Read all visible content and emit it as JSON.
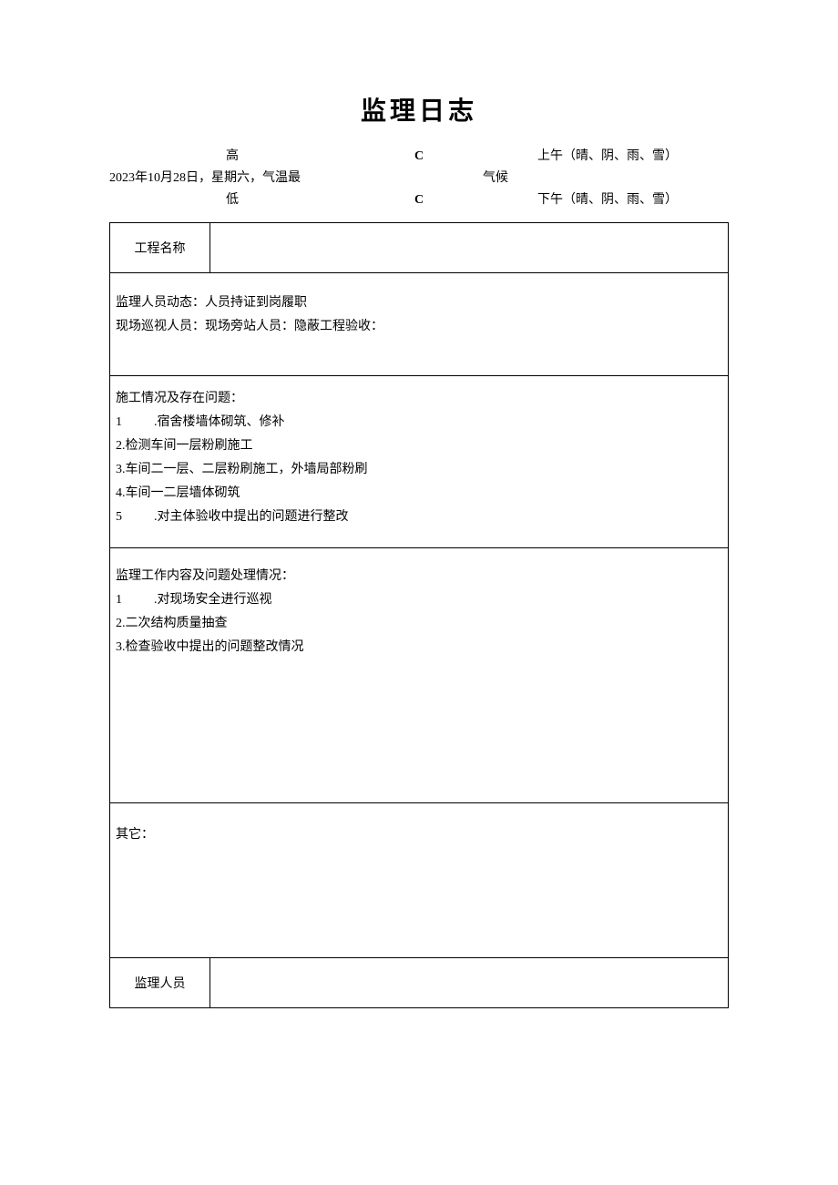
{
  "title": "监理日志",
  "header": {
    "date_text": "2023年10月28日，星期六，气温最",
    "high": "高",
    "low": "低",
    "C": "C",
    "climate": "气候",
    "morning": "上午（晴、阴、雨、雪）",
    "afternoon": "下午（晴、阴、雨、雪）"
  },
  "labels": {
    "project_name": "工程名称",
    "supervisor": "监理人员"
  },
  "section1": {
    "line1": "监理人员动态：人员持证到岗履职",
    "line2": "现场巡视人员：现场旁站人员：隐蔽工程验收："
  },
  "section2": {
    "header": "施工情况及存在问题：",
    "items": [
      "1          .宿舍楼墙体砌筑、修补",
      "2.检测车间一层粉刷施工",
      "3.车间二一层、二层粉刷施工，外墙局部粉刷",
      "4.车间一二层墙体砌筑",
      "5          .对主体验收中提出的问题进行整改"
    ]
  },
  "section3": {
    "header": "监理工作内容及问题处理情况：",
    "items": [
      "1          .对现场安全进行巡视",
      "2.二次结构质量抽查",
      "3.检查验收中提出的问题整改情况"
    ]
  },
  "section4": {
    "header": "其它："
  }
}
